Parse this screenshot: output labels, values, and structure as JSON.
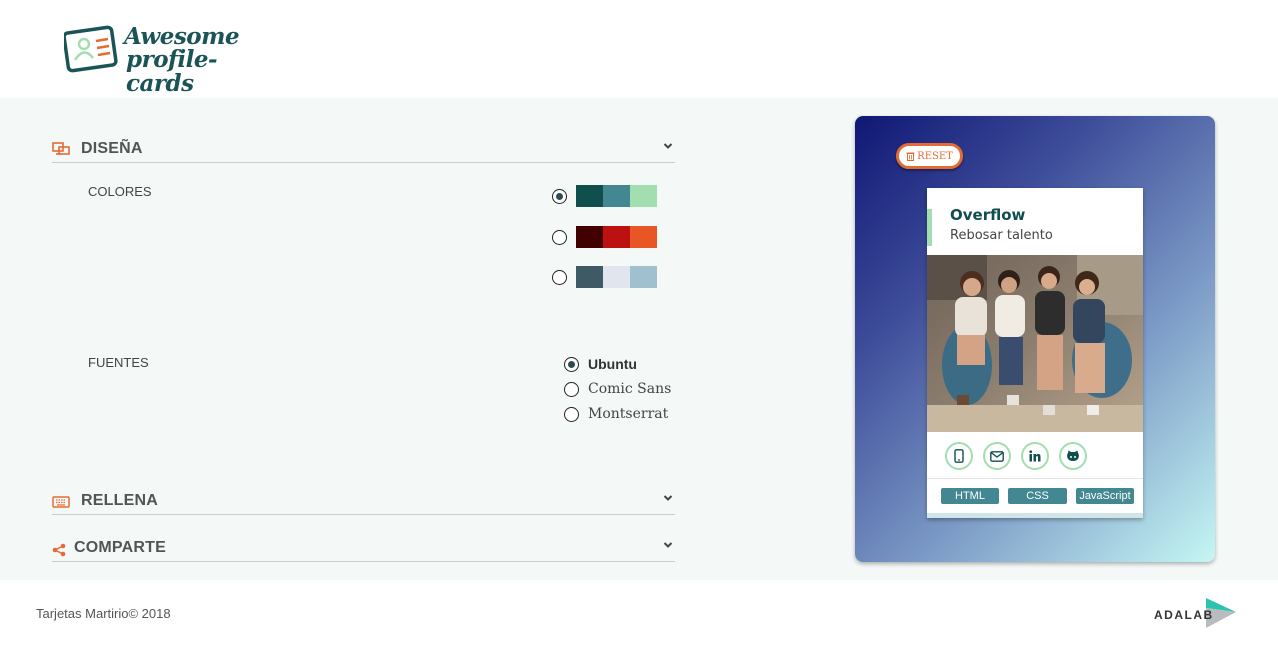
{
  "header": {
    "logo_line1": "Awesome",
    "logo_line2": "profile-cards"
  },
  "sections": {
    "disena": {
      "title": "DISEÑA"
    },
    "rellena": {
      "title": "RELLENA"
    },
    "comparte": {
      "title": "COMPARTE"
    }
  },
  "colores": {
    "label": "COLORES",
    "selected_index": 0,
    "palettes": [
      {
        "colors": [
          "#114e4e",
          "#438792",
          "#a2deaf"
        ]
      },
      {
        "colors": [
          "#420101",
          "#bd1010",
          "#e95626"
        ]
      },
      {
        "colors": [
          "#3e5b65",
          "#e1e5ed",
          "#a0c0cf"
        ]
      }
    ]
  },
  "fuentes": {
    "label": "FUENTES",
    "options": [
      "Ubuntu",
      "Comic Sans",
      "Montserrat"
    ],
    "selected": "Ubuntu"
  },
  "preview": {
    "reset_label": "RESET",
    "card": {
      "name": "Overflow",
      "job": "Rebosar talento",
      "social_icons": [
        "mobile-icon",
        "envelope-icon",
        "linkedin-icon",
        "github-icon"
      ],
      "skills": [
        "HTML",
        "CSS",
        "JavaScript"
      ]
    }
  },
  "footer": {
    "copyright": "Tarjetas Martirio© 2018",
    "brand": "ADALAB"
  },
  "colors": {
    "accent_orange": "#e36c34",
    "brand_teal": "#1a5456",
    "mint": "#a2deaf"
  }
}
